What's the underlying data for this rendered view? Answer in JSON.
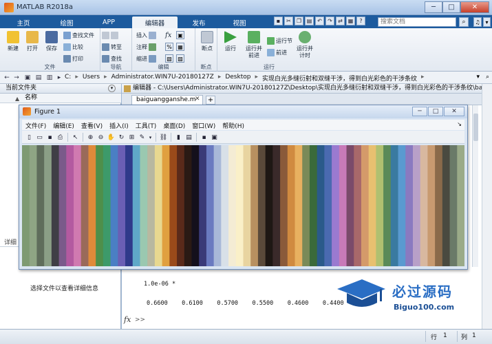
{
  "window": {
    "title": "MATLAB R2018a",
    "minimize": "─",
    "maximize": "□",
    "close": "✕"
  },
  "ribbon_tabs": [
    {
      "label": "主页"
    },
    {
      "label": "绘图"
    },
    {
      "label": "APP"
    },
    {
      "label": "编辑器"
    },
    {
      "label": "发布"
    },
    {
      "label": "视图"
    }
  ],
  "search": {
    "placeholder": "搜索文档"
  },
  "ribbon": {
    "file": {
      "label": "文件",
      "new": "新建",
      "open": "打开",
      "save": "保存",
      "find_files": "查找文件",
      "compare": "比较",
      "print": "打印"
    },
    "navigate": {
      "label": "导航",
      "goto": "转至",
      "find": "查找"
    },
    "edit": {
      "label": "编辑",
      "insert": "插入",
      "comment": "注释",
      "indent": "缩进",
      "fx": "fx"
    },
    "breakpoints": {
      "label": "断点",
      "breakpoint": "断点"
    },
    "run": {
      "label": "运行",
      "run": "运行",
      "run_advance": "运行并\n前进",
      "run_section": "运行节",
      "advance": "前进",
      "run_time": "运行并\n计时"
    }
  },
  "address": {
    "parts": [
      "C:",
      "Users",
      "Administrator.WIN7U-20180127Z",
      "Desktop",
      "实现白光多缝衍射和双缝干涉，得到白光彩色的干涉条纹"
    ]
  },
  "left_panel": {
    "title": "当前文件夹",
    "column": "名称",
    "details_label": "详细",
    "details_message": "选择文件以查看详细信息"
  },
  "editor": {
    "header": "编辑器 - C:\\Users\\Administrator.WIN7U-20180127Z\\Desktop\\实现白光多缝衍射和双缝干涉，得到白光彩色的干涉条纹\\baigua...",
    "tab": "baiguangganshe.m"
  },
  "command": {
    "line1": "1.0e-06 *",
    "line2": "0.6600    0.6100    0.5700    0.5500    0.4600    0.4400    0.",
    "prompt": ">>"
  },
  "figure": {
    "title": "Figure 1",
    "menu": [
      "文件(F)",
      "编辑(E)",
      "查看(V)",
      "插入(I)",
      "工具(T)",
      "桌面(D)",
      "窗口(W)",
      "帮助(H)"
    ]
  },
  "statusbar": {
    "row_label": "行",
    "row_value": "1",
    "col_label": "列",
    "col_value": "1"
  },
  "watermark": {
    "text": "必过源码",
    "sub": "Biguo100.com"
  },
  "colors": {
    "ribbon_blue": "#1d5b9e",
    "accent": "#2a6ec4"
  },
  "stripes": [
    "#7e9a72",
    "#8fa584",
    "#5f6d5b",
    "#8b9f86",
    "#3f3f46",
    "#7a5a8a",
    "#b35aa0",
    "#d07ab0",
    "#9a6a5a",
    "#e08a3a",
    "#4f8f4a",
    "#3d9a6a",
    "#4a7fc4",
    "#6a5fb4",
    "#2f3a8a",
    "#5fa8c8",
    "#9ac8b0",
    "#b8b8a0",
    "#e8d890",
    "#e0a040",
    "#9a4a1a",
    "#5a2a1a",
    "#2a1a14",
    "#14101c",
    "#3a3a78",
    "#6a7ac0",
    "#a8b8d8",
    "#d8e0e8",
    "#f4ecd4",
    "#faf0c8",
    "#e8d4a0",
    "#b89060",
    "#5a4a3a",
    "#1e1814",
    "#3a2a2a",
    "#8a5a3a",
    "#d08a40",
    "#e8b060",
    "#7a8a58",
    "#3a6a3a",
    "#2a5a8a",
    "#4a6ab0",
    "#9a7ad0",
    "#c87ab8",
    "#7a4a6a",
    "#a8686a",
    "#d49a6a",
    "#e8c070",
    "#b0c070",
    "#5a8a58",
    "#3a7aa0",
    "#5a9ad0",
    "#8a7ac0",
    "#b8a0c8",
    "#d8b8a0",
    "#c89a70",
    "#8a6a4a",
    "#4a4a40",
    "#6a7a68",
    "#9aaa88"
  ]
}
